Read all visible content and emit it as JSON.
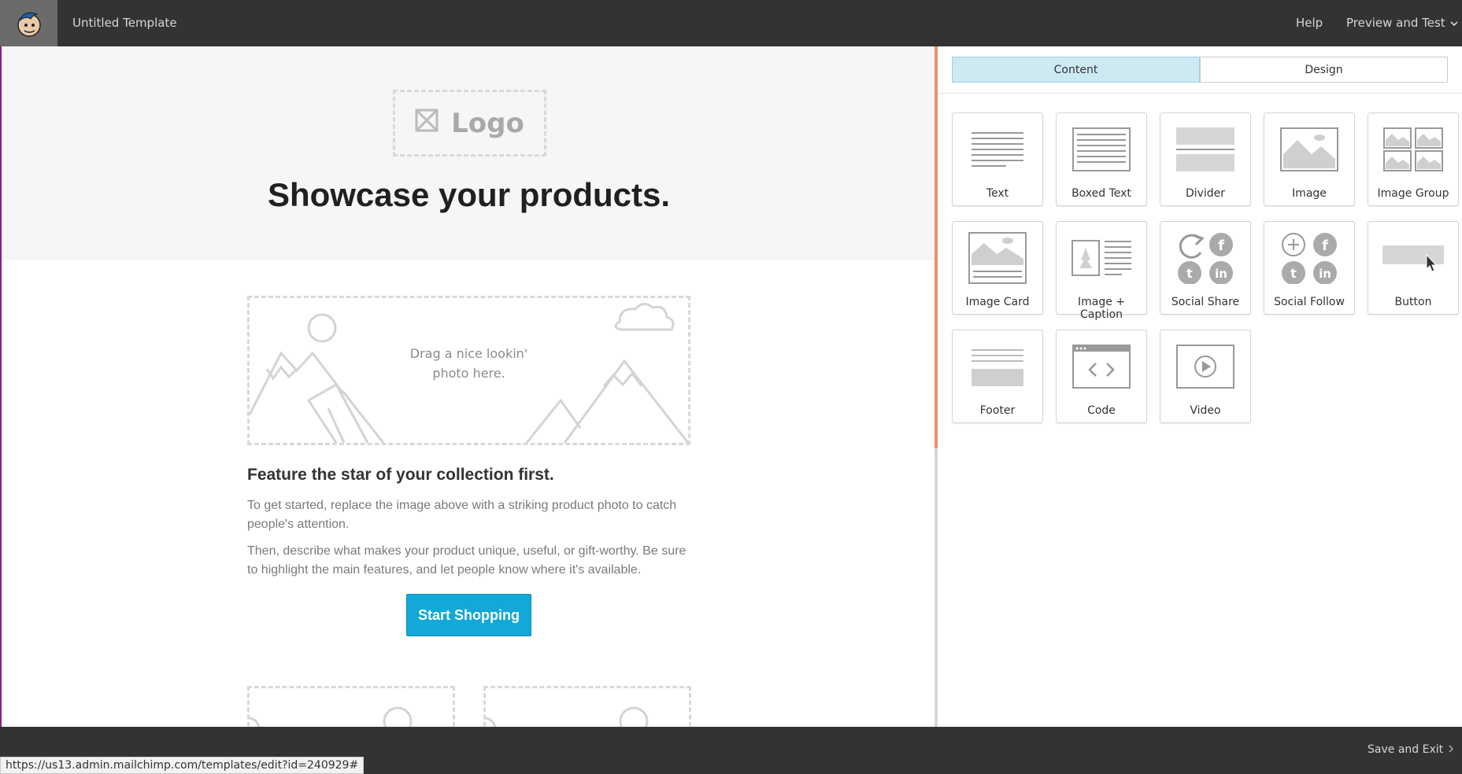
{
  "topbar": {
    "logo_icon": "mailchimp-freddie-icon",
    "title": "Untitled Template",
    "help": "Help",
    "preview": "Preview and Test"
  },
  "canvas": {
    "logo_placeholder": "Logo",
    "hero_title": "Showcase your products.",
    "photo_placeholder_line1": "Drag a nice lookin'",
    "photo_placeholder_line2": "photo here.",
    "feature_title": "Feature the star of your collection first.",
    "paragraph1": "To get started, replace the image above with a striking product photo to catch people's attention.",
    "paragraph2": "Then, describe what makes your product unique, useful, or gift-worthy. Be sure to highlight the main features, and let people know where it's available.",
    "button_label": "Start Shopping",
    "button_color": "#13a8d8"
  },
  "panel": {
    "tabs": [
      {
        "label": "Content",
        "active": true
      },
      {
        "label": "Design",
        "active": false
      }
    ],
    "blocks": [
      {
        "label": "Text",
        "icon": "text-block-icon"
      },
      {
        "label": "Boxed Text",
        "icon": "boxed-text-block-icon"
      },
      {
        "label": "Divider",
        "icon": "divider-block-icon"
      },
      {
        "label": "Image",
        "icon": "image-block-icon"
      },
      {
        "label": "Image Group",
        "icon": "image-group-block-icon"
      },
      {
        "label": "Image Card",
        "icon": "image-card-block-icon"
      },
      {
        "label": "Image + Caption",
        "icon": "image-caption-block-icon"
      },
      {
        "label": "Social Share",
        "icon": "social-share-block-icon"
      },
      {
        "label": "Social Follow",
        "icon": "social-follow-block-icon"
      },
      {
        "label": "Button",
        "icon": "button-block-icon"
      },
      {
        "label": "Footer",
        "icon": "footer-block-icon"
      },
      {
        "label": "Code",
        "icon": "code-block-icon"
      },
      {
        "label": "Video",
        "icon": "video-block-icon"
      }
    ]
  },
  "bottombar": {
    "save_exit": "Save and Exit"
  },
  "status": {
    "url": "https://us13.admin.mailchimp.com/templates/edit?id=240929#"
  },
  "colors": {
    "topbar": "#333333",
    "accent_tab": "#cdeaf3",
    "divider_accent": "#ef8f6d"
  }
}
